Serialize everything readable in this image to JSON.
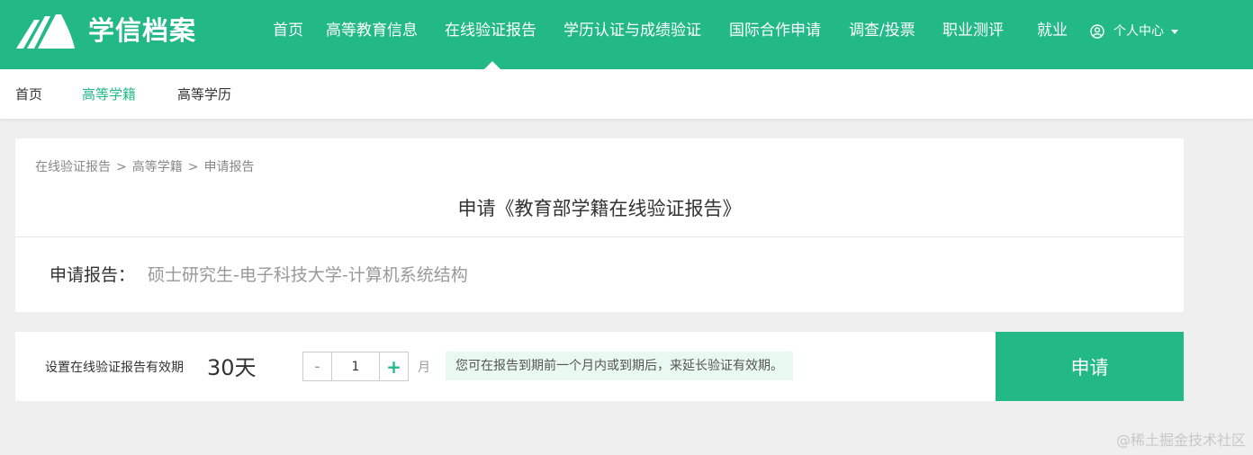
{
  "header": {
    "logo_text": "学信档案",
    "nav": [
      {
        "label": "首页"
      },
      {
        "label": "高等教育信息"
      },
      {
        "label": "在线验证报告"
      },
      {
        "label": "学历认证与成绩验证"
      },
      {
        "label": "国际合作申请"
      },
      {
        "label": "调查/投票"
      },
      {
        "label": "职业测评"
      },
      {
        "label": "就业"
      }
    ],
    "active_nav": "在线验证报告",
    "user_center": "个人中心"
  },
  "subnav": {
    "items": [
      {
        "label": "首页"
      },
      {
        "label": "高等学籍"
      },
      {
        "label": "高等学历"
      }
    ],
    "active": "高等学籍"
  },
  "breadcrumb": {
    "items": [
      "在线验证报告",
      "高等学籍",
      "申请报告"
    ],
    "separator": ">"
  },
  "page_title": "申请《教育部学籍在线验证报告》",
  "report": {
    "label": "申请报告：",
    "value": "硕士研究生-电子科技大学-计算机系统结构"
  },
  "validity": {
    "label": "设置在线验证报告有效期",
    "days": "30天",
    "stepper_minus": "-",
    "stepper_plus": "+",
    "months_value": "1",
    "unit": "月",
    "hint": "您可在报告到期前一个月内或到期后，来延长验证有效期。",
    "apply_label": "申请"
  },
  "watermark": "@稀土掘金技术社区",
  "colors": {
    "brand": "#22b986",
    "hint_bg": "#eaf8f2"
  }
}
